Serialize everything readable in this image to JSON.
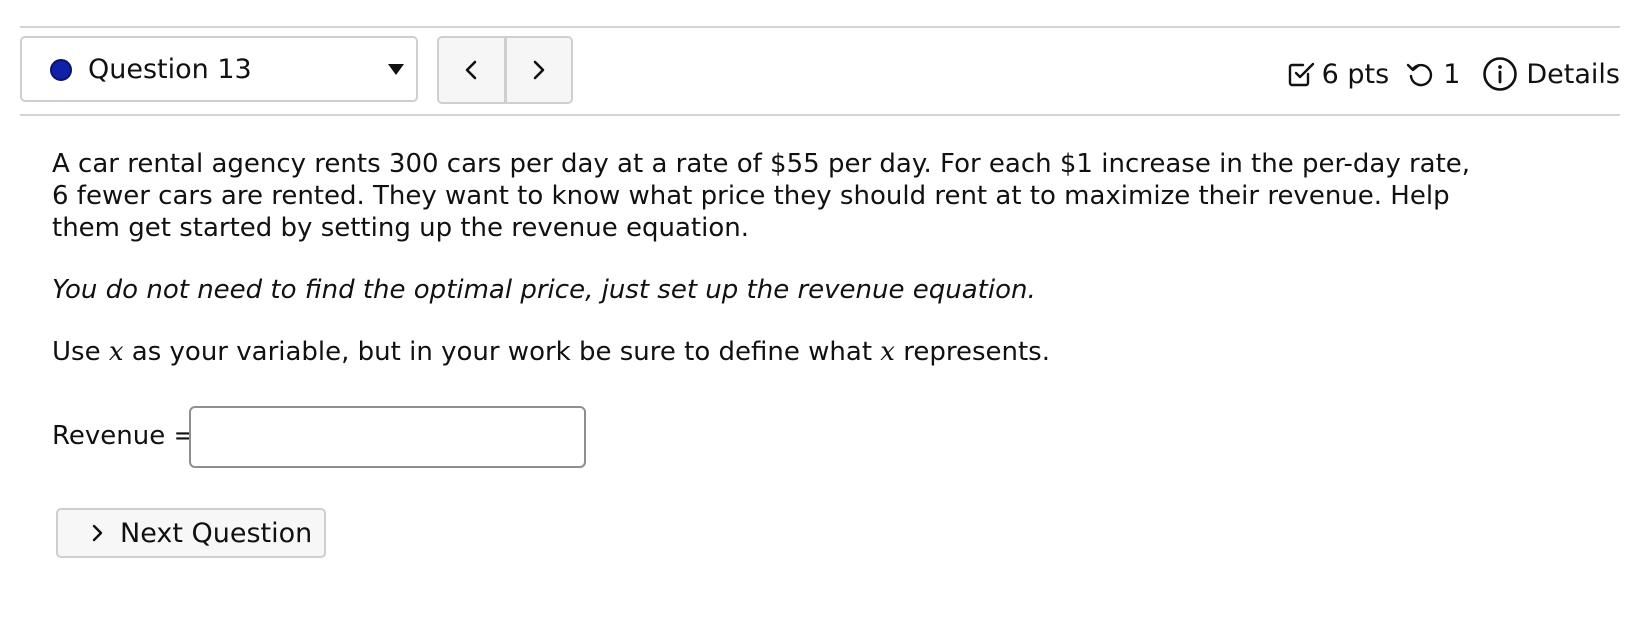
{
  "question_selector": {
    "label": "Question 13",
    "dot_color": "#0f21a8"
  },
  "pager": {
    "prev_icon": "chevron-left-icon",
    "next_icon": "chevron-right-icon"
  },
  "meta": {
    "points_label": "6 pts",
    "retries_label": "1",
    "details_label": "Details"
  },
  "question": {
    "prompt": "A car rental agency rents 300 cars per day at a rate of $55 per day. For each $1 increase in the per-day rate, 6 fewer cars are rented. They want to know what price they should rent at to maximize their revenue. Help them get started by setting up the revenue equation.",
    "note": "You do not need to find the optimal price, just set up the revenue equation.",
    "var_instruction_prefix": "Use",
    "var_symbol": "x",
    "var_instruction_middle": "as your variable, but in your work be sure to define what",
    "var_instruction_suffix": "represents."
  },
  "answer": {
    "label": "Revenue =",
    "value": ""
  },
  "next_button": {
    "label": "Next Question"
  }
}
